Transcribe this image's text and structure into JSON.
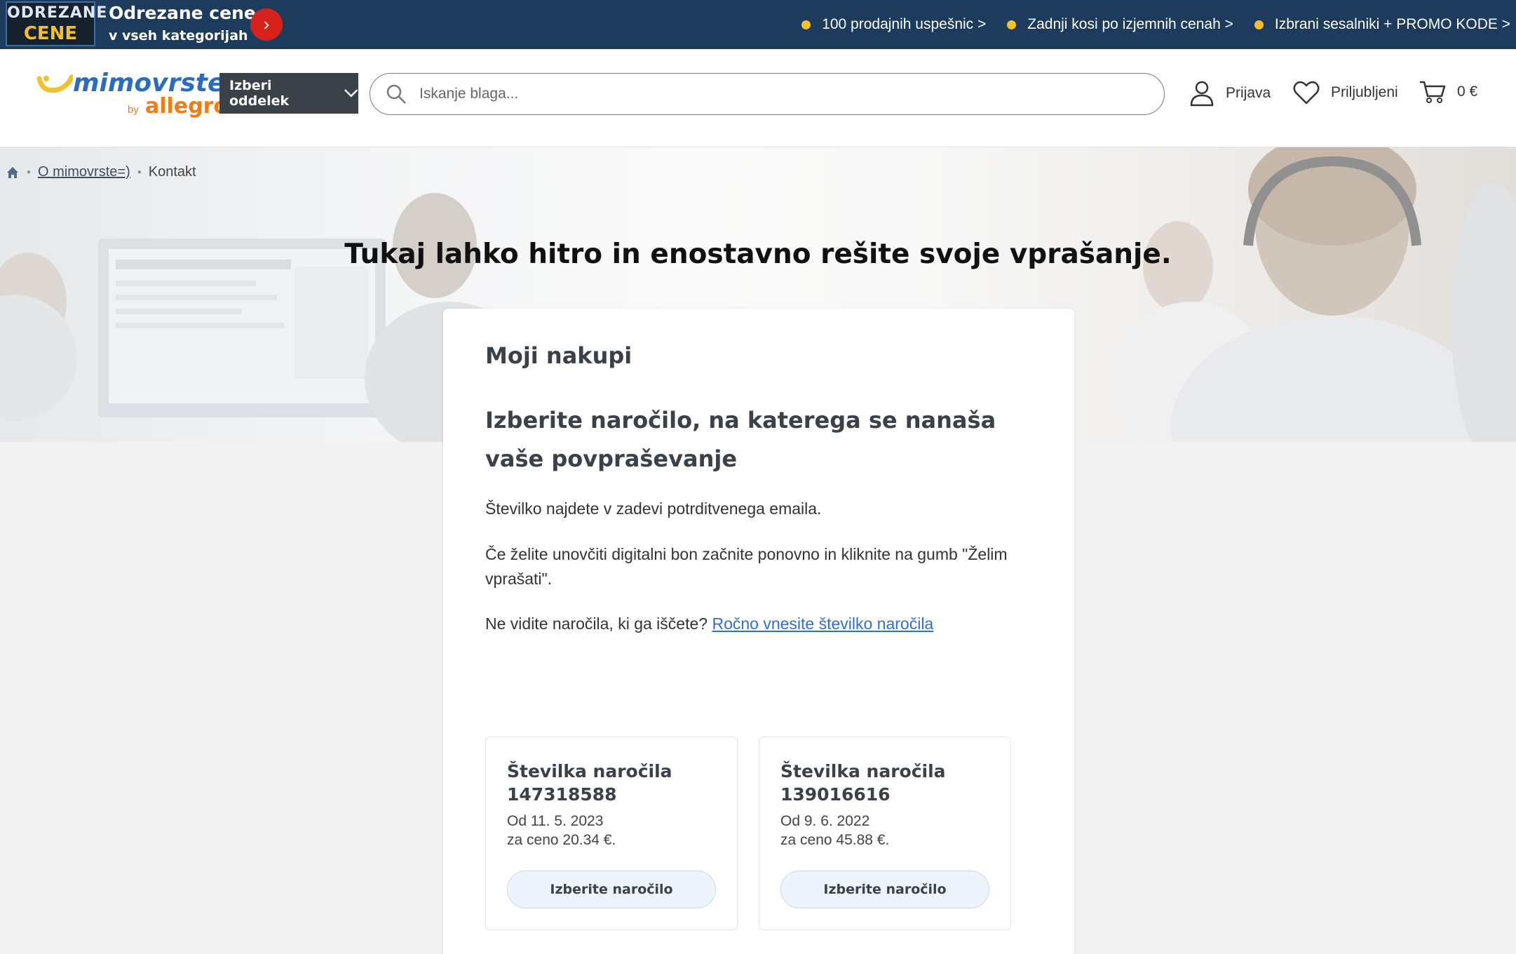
{
  "promo": {
    "badge_line1": "ODREZANE",
    "badge_line2": "CENE",
    "title": "Odrezane cene",
    "subtitle": "v vseh kategorijah",
    "links": [
      "100 prodajnih uspešnic >",
      "Zadnji kosi po izjemnih cenah >",
      "Izbrani sesalniki + PROMO KODE >"
    ]
  },
  "header": {
    "logo_main": "mimovrste",
    "logo_by": "by",
    "logo_allegro": "allegro",
    "dept_label": "Izberi oddelek",
    "search_placeholder": "Iskanje blaga...",
    "login_label": "Prijava",
    "favorites_label": "Priljubljeni",
    "cart_label": "0 €"
  },
  "breadcrumb": {
    "items": [
      "O mimovrste=)",
      "Kontakt"
    ]
  },
  "hero": {
    "title": "Tukaj lahko hitro in enostavno rešite svoje vprašanje."
  },
  "card": {
    "heading": "Moji nakupi",
    "subheading": "Izberite naročilo, na katerega se nanaša vaše povpraševanje",
    "p1": "Številko najdete v zadevi potrditvenega emaila.",
    "p2": "Če želite unovčiti digitalni bon začnite ponovno in kliknite na gumb \"Želim vprašati\".",
    "p3_text": "Ne vidite naročila, ki ga iščete?",
    "p3_link": "Ročno vnesite številko naročila"
  },
  "orders": [
    {
      "title_label": "Številka naročila",
      "number": "147318588",
      "date": "Od 11. 5. 2023",
      "price": "za ceno 20.34 €.",
      "button": "Izberite naročilo"
    },
    {
      "title_label": "Številka naročila",
      "number": "139016616",
      "date": "Od 9. 6. 2022",
      "price": "za ceno 45.88 €.",
      "button": "Izberite naročilo"
    }
  ],
  "colors": {
    "promo_bg": "#1d3b5c",
    "brand_blue": "#2a6cbf",
    "brand_orange": "#f07d16",
    "link": "#2d6fd6",
    "dept_bg": "#3a4149"
  }
}
